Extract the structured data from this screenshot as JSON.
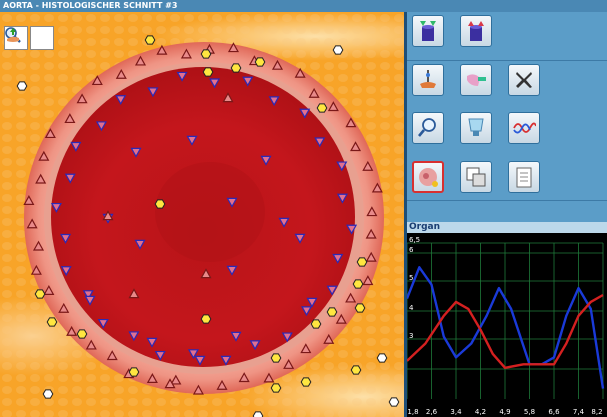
{
  "window": {
    "title": "AORTA - HISTOLOGISCHER SCHNITT #3"
  },
  "viewer_tools": [
    {
      "name": "zoom-tool",
      "icon": "magnifier-icon"
    },
    {
      "name": "pointer-tool",
      "icon": "hand-pointer-icon"
    }
  ],
  "toolbar": [
    {
      "name": "slide-down-button",
      "icon": "cylinder-green-arrows-icon"
    },
    {
      "name": "slide-up-button",
      "icon": "cylinder-red-arrows-icon"
    },
    {
      "name": "lab-tool-button",
      "icon": "lab-burner-icon"
    },
    {
      "name": "pipette-button",
      "icon": "syringe-icon"
    },
    {
      "name": "close-tool-button",
      "icon": "x-icon"
    },
    {
      "name": "magnify-tool-button",
      "icon": "magnifier-icon"
    },
    {
      "name": "vessel-button",
      "icon": "vessel-icon"
    },
    {
      "name": "wave-button",
      "icon": "wave-icon"
    },
    {
      "name": "organ-button",
      "icon": "organ-icon"
    },
    {
      "name": "transform-button",
      "icon": "transform-icon"
    },
    {
      "name": "report-button",
      "icon": "clipboard-icon"
    }
  ],
  "graph": {
    "title": "Organ",
    "y_ticks": [
      "6,5",
      "6",
      "5",
      "4",
      "3"
    ],
    "x_ticks": [
      "1,8",
      "2,6",
      "3,4",
      "4,2",
      "4,9",
      "5,8",
      "6,6",
      "7,4",
      "8,2"
    ]
  },
  "chart_data": {
    "type": "line",
    "x_ticks": [
      "1,8",
      "2,6",
      "3,4",
      "4,2",
      "4,9",
      "5,8",
      "6,6",
      "7,4",
      "8,2"
    ],
    "y_ticks": [
      "6,5",
      "6",
      "5",
      "4",
      "3"
    ],
    "xlim": [
      1.8,
      8.2
    ],
    "ylim": [
      2.0,
      6.5
    ],
    "grid": true,
    "series": [
      {
        "color": "#1a3ad8",
        "x": [
          1.8,
          2.2,
          2.6,
          3.0,
          3.4,
          3.9,
          4.4,
          4.8,
          5.2,
          5.8,
          6.2,
          6.6,
          7.0,
          7.4,
          7.8,
          8.2
        ],
        "y": [
          4.9,
          5.8,
          5.3,
          3.8,
          3.2,
          3.6,
          4.4,
          5.2,
          4.6,
          3.0,
          3.0,
          3.2,
          4.4,
          5.2,
          4.6,
          2.3
        ]
      },
      {
        "color": "#d42020",
        "x": [
          1.8,
          2.4,
          3.0,
          3.4,
          3.8,
          4.2,
          4.6,
          5.0,
          5.6,
          6.2,
          6.6,
          7.0,
          7.4,
          7.8,
          8.2
        ],
        "y": [
          3.1,
          3.6,
          4.4,
          4.8,
          4.6,
          4.0,
          3.3,
          2.9,
          3.0,
          3.0,
          3.0,
          3.6,
          4.4,
          4.8,
          5.0
        ]
      }
    ]
  },
  "colors": {
    "lumen": "#c8161e",
    "wall": "#e87a6a",
    "fat": "#f8a428",
    "titlebar": "#4a88b4",
    "panel": "#5b9dc8"
  }
}
